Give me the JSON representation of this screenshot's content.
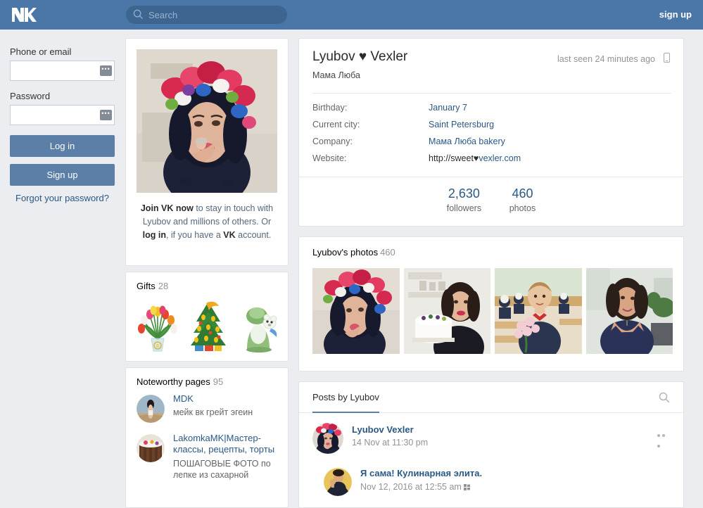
{
  "header": {
    "logo": "vk-logo",
    "search": {
      "placeholder": "Search",
      "value": "",
      "icon": "search-icon"
    },
    "signup_label": "sign up",
    "bg_color": "#4a76a8",
    "search_bg": "#3c658f"
  },
  "login": {
    "phone_label": "Phone or email",
    "phone_value": "",
    "password_label": "Password",
    "password_value": "",
    "badge": "•••",
    "login_button": "Log in",
    "signup_button": "Sign up",
    "forgot_link": "Forgot your password?",
    "button_color": "#5b7fa6",
    "link_color": "#2a5885"
  },
  "profile_photo_card": {
    "avatar_name": "lyubov-profile-photo",
    "join_line_1_bold": "Join VK now",
    "join_line_1_rest": " to stay in touch with Lyubov and millions of others. Or ",
    "join_login_bold": "log in",
    "join_line_2_rest": ", if you have a ",
    "join_vk_bold": "VK",
    "join_line_3_rest": " account."
  },
  "gifts": {
    "title": "Gifts",
    "count": "28",
    "items": [
      {
        "name": "gift-tulips-bouquet"
      },
      {
        "name": "gift-christmas-tree"
      },
      {
        "name": "gift-bear-in-green-hat"
      }
    ]
  },
  "noteworthy": {
    "title": "Noteworthy pages",
    "count": "95",
    "items": [
      {
        "name": "MDK",
        "desc": "мейк вк грейт эгеин",
        "avatar": "mdk-avatar"
      },
      {
        "name": "LakomkaMK|Мастер-классы, рецепты, торты",
        "desc": "ПОШАГОВЫЕ ФОТО по лепке из сахарной",
        "avatar": "lakomka-avatar"
      }
    ]
  },
  "profile": {
    "name": "Lyubov ♥ Vexler",
    "subtitle": "Мама Люба",
    "last_seen": "last seen 24 minutes ago",
    "last_seen_icon": "mobile-phone-icon",
    "info": [
      {
        "key": "Birthday:",
        "value": "January 7",
        "link": true
      },
      {
        "key": "Current city:",
        "value": "Saint Petersburg",
        "link": true
      },
      {
        "key": "Company:",
        "value": "Мама Люба bakery",
        "link": true
      },
      {
        "key": "Website:",
        "value": "http://sweet♥vexler.com",
        "value_dark": "http://sweet♥",
        "value_link": "vexler.com",
        "link": true
      }
    ],
    "stats": [
      {
        "num": "2,630",
        "label": "followers"
      },
      {
        "num": "460",
        "label": "photos"
      }
    ]
  },
  "photos": {
    "title": "Lyubov's photos",
    "count": "460",
    "items": [
      {
        "name": "photo-flower-crown-portrait"
      },
      {
        "name": "photo-holding-white-cake"
      },
      {
        "name": "photo-boy-with-roses-classroom"
      },
      {
        "name": "photo-blue-dress-portrait"
      }
    ]
  },
  "posts": {
    "tab_label": "Posts by Lyubov",
    "search_icon": "search-icon",
    "active_tab_color": "#5b7fa6",
    "entries": [
      {
        "author": "Lyubov Vexler",
        "date": "14 Nov at 11:30 pm",
        "avatar": "lyubov-post-avatar",
        "menu_icon": "more-options-icon"
      }
    ],
    "repost": {
      "author": "Я сама! Кулинарная элита.",
      "date": "Nov 12, 2016 at 12:55 am",
      "avatar": "kulinarnaya-elita-avatar",
      "platform_icon": "windows-icon"
    }
  }
}
